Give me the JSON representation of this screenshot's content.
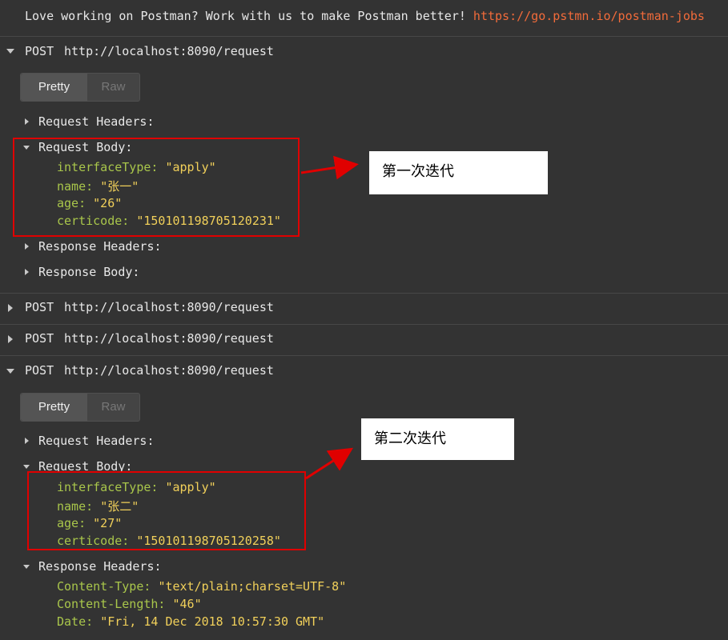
{
  "banner": {
    "text": "Love working on Postman? Work with us to make Postman better! ",
    "link": "https://go.pstmn.io/postman-jobs"
  },
  "requests": [
    {
      "method": "POST",
      "url": "http://localhost:8090/request",
      "expanded": true,
      "tabs": {
        "pretty": "Pretty",
        "raw": "Raw"
      },
      "request_headers_label": "Request Headers:",
      "request_body_label": "Request Body:",
      "body": [
        {
          "key": "interfaceType:",
          "value": "\"apply\""
        },
        {
          "key": "name:",
          "value": "\"张一\""
        },
        {
          "key": "age:",
          "value": "\"26\""
        },
        {
          "key": "certicode:",
          "value": "\"150101198705120231\""
        }
      ],
      "response_headers_label": "Response Headers:",
      "response_body_label": "Response Body:"
    },
    {
      "method": "POST",
      "url": "http://localhost:8090/request",
      "expanded": false
    },
    {
      "method": "POST",
      "url": "http://localhost:8090/request",
      "expanded": false
    },
    {
      "method": "POST",
      "url": "http://localhost:8090/request",
      "expanded": true,
      "tabs": {
        "pretty": "Pretty",
        "raw": "Raw"
      },
      "request_headers_label": "Request Headers:",
      "request_body_label": "Request Body:",
      "body": [
        {
          "key": "interfaceType:",
          "value": "\"apply\""
        },
        {
          "key": "name:",
          "value": "\"张二\""
        },
        {
          "key": "age:",
          "value": "\"27\""
        },
        {
          "key": "certicode:",
          "value": "\"150101198705120258\""
        }
      ],
      "response_headers_label": "Response Headers:",
      "response_headers": [
        {
          "key": "Content-Type:",
          "value": "\"text/plain;charset=UTF-8\""
        },
        {
          "key": "Content-Length:",
          "value": "\"46\""
        },
        {
          "key": "Date:",
          "value": "\"Fri, 14 Dec 2018 10:57:30 GMT\""
        }
      ]
    }
  ],
  "annotations": {
    "first": "第一次迭代",
    "second": "第二次迭代"
  },
  "colors": {
    "background": "#333333",
    "link": "#f26b3a",
    "key": "#a9c64b",
    "value": "#f1d05a",
    "annotation_red": "#e00000"
  }
}
